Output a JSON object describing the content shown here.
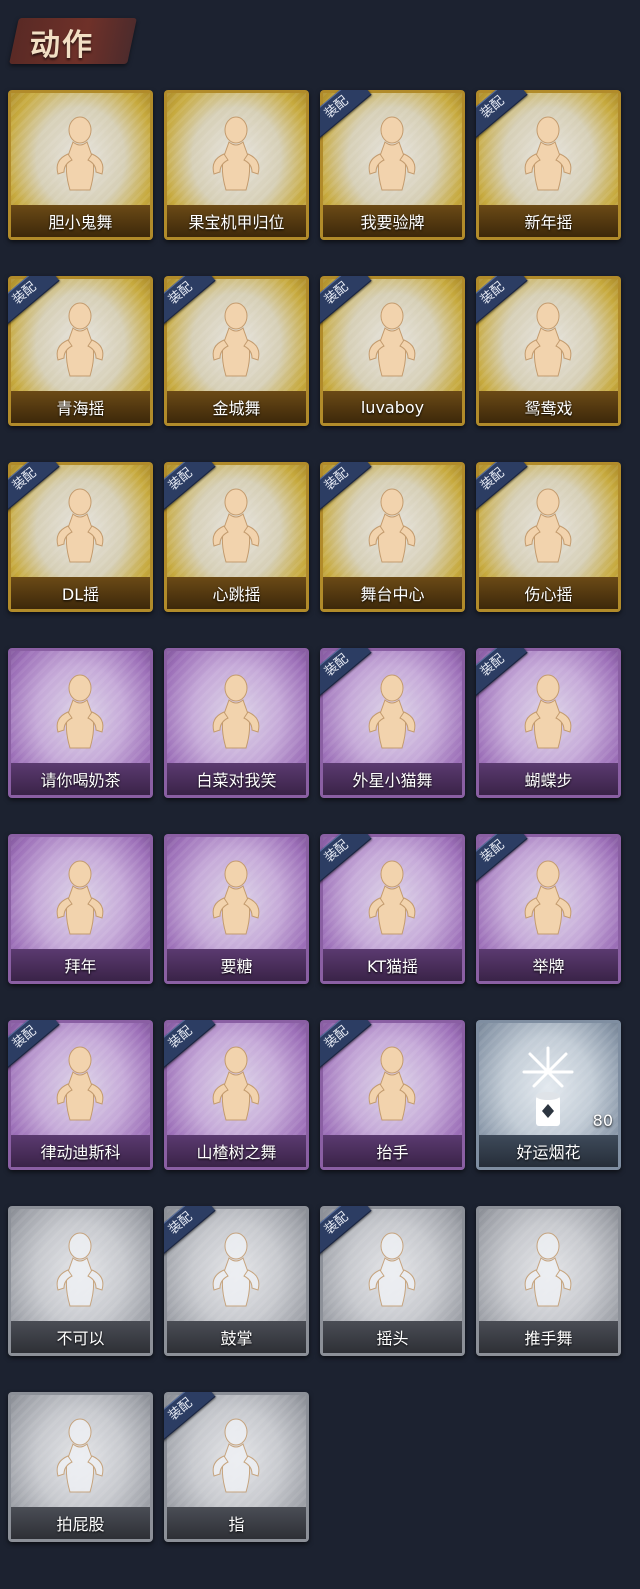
{
  "header": {
    "title": "动作"
  },
  "equip_badge": "装配",
  "colors": {
    "gold": "#c7aa3e",
    "purple": "#9c6fb8",
    "silver": "#9ea1a8",
    "blue": "#8c9aab",
    "ribbon": "#2c3d63"
  },
  "items": [
    {
      "label": "胆小鬼舞",
      "rarity": "gold",
      "equipped": false,
      "icon": "emote-figure-icon"
    },
    {
      "label": "果宝机甲归位",
      "rarity": "gold",
      "equipped": false,
      "icon": "emote-figure-icon"
    },
    {
      "label": "我要验牌",
      "rarity": "gold",
      "equipped": true,
      "icon": "emote-figure-icon"
    },
    {
      "label": "新年摇",
      "rarity": "gold",
      "equipped": true,
      "icon": "emote-figure-icon"
    },
    {
      "label": "青海摇",
      "rarity": "gold",
      "equipped": true,
      "icon": "emote-figure-icon"
    },
    {
      "label": "金城舞",
      "rarity": "gold",
      "equipped": true,
      "icon": "emote-figure-icon"
    },
    {
      "label": "luvaboy",
      "rarity": "gold",
      "equipped": true,
      "icon": "emote-figure-icon"
    },
    {
      "label": "鸳鸯戏",
      "rarity": "gold",
      "equipped": true,
      "icon": "emote-figure-icon"
    },
    {
      "label": "DL摇",
      "rarity": "gold",
      "equipped": true,
      "icon": "emote-figure-icon"
    },
    {
      "label": "心跳摇",
      "rarity": "gold",
      "equipped": true,
      "icon": "emote-figure-icon"
    },
    {
      "label": "舞台中心",
      "rarity": "gold",
      "equipped": true,
      "icon": "emote-figure-icon"
    },
    {
      "label": "伤心摇",
      "rarity": "gold",
      "equipped": true,
      "icon": "emote-figure-icon"
    },
    {
      "label": "请你喝奶茶",
      "rarity": "purple",
      "equipped": false,
      "icon": "emote-figure-icon"
    },
    {
      "label": "白菜对我笑",
      "rarity": "purple",
      "equipped": false,
      "icon": "emote-figure-icon"
    },
    {
      "label": "外星小猫舞",
      "rarity": "purple",
      "equipped": true,
      "icon": "emote-figure-icon"
    },
    {
      "label": "蝴蝶步",
      "rarity": "purple",
      "equipped": true,
      "icon": "emote-figure-icon"
    },
    {
      "label": "拜年",
      "rarity": "purple",
      "equipped": false,
      "icon": "emote-figure-icon"
    },
    {
      "label": "要糖",
      "rarity": "purple",
      "equipped": false,
      "icon": "emote-figure-icon"
    },
    {
      "label": "KT猫摇",
      "rarity": "purple",
      "equipped": true,
      "icon": "emote-figure-icon"
    },
    {
      "label": "举牌",
      "rarity": "purple",
      "equipped": true,
      "icon": "emote-figure-icon"
    },
    {
      "label": "律动迪斯科",
      "rarity": "purple",
      "equipped": true,
      "icon": "emote-figure-icon"
    },
    {
      "label": "山楂树之舞",
      "rarity": "purple",
      "equipped": true,
      "icon": "emote-figure-icon"
    },
    {
      "label": "抬手",
      "rarity": "purple",
      "equipped": true,
      "icon": "emote-figure-icon"
    },
    {
      "label": "好运烟花",
      "rarity": "blue",
      "equipped": false,
      "icon": "firework-icon",
      "count": "80"
    },
    {
      "label": "不可以",
      "rarity": "silver",
      "equipped": false,
      "icon": "emote-figure-icon"
    },
    {
      "label": "鼓掌",
      "rarity": "silver",
      "equipped": true,
      "icon": "emote-figure-icon"
    },
    {
      "label": "摇头",
      "rarity": "silver",
      "equipped": true,
      "icon": "emote-figure-icon"
    },
    {
      "label": "推手舞",
      "rarity": "silver",
      "equipped": false,
      "icon": "emote-figure-icon"
    },
    {
      "label": "拍屁股",
      "rarity": "silver",
      "equipped": false,
      "icon": "emote-figure-icon"
    },
    {
      "label": "指",
      "rarity": "silver",
      "equipped": true,
      "icon": "emote-figure-icon"
    }
  ]
}
